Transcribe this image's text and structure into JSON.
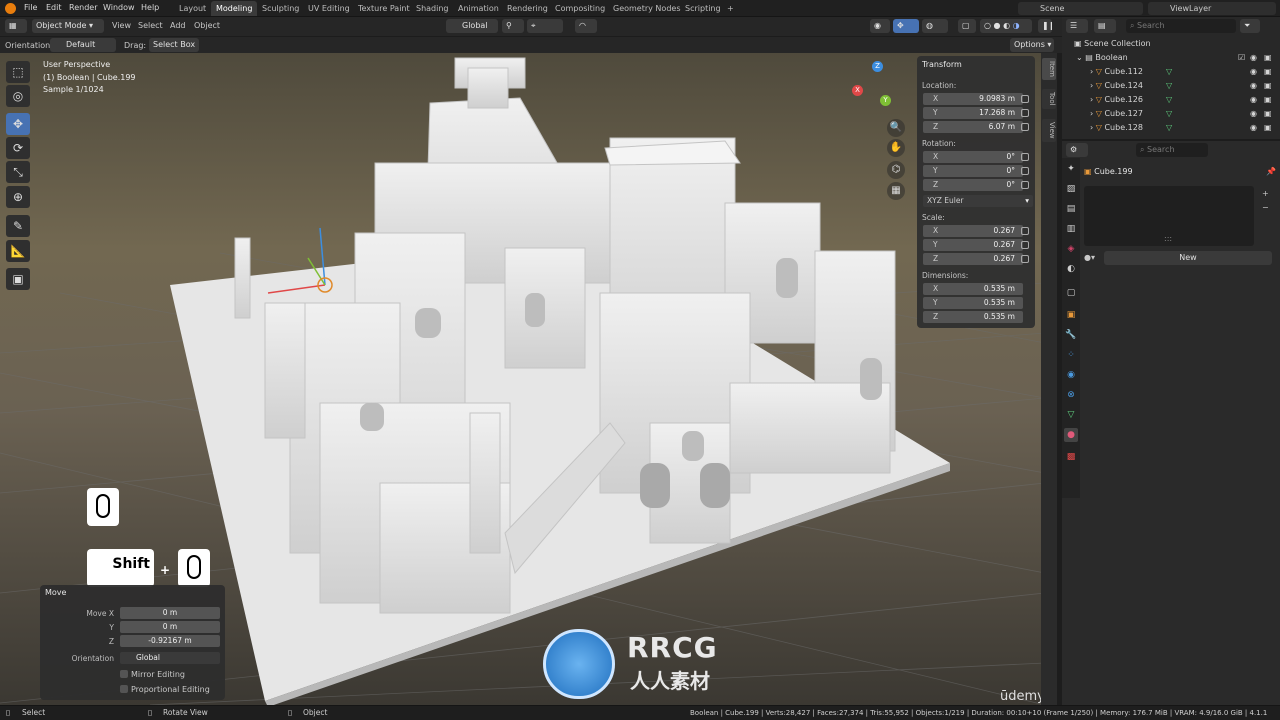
{
  "topbar": {
    "menus": [
      "File",
      "Edit",
      "Render",
      "Window",
      "Help"
    ],
    "workspaces": [
      "Layout",
      "Modeling",
      "Sculpting",
      "UV Editing",
      "Texture Paint",
      "Shading",
      "Animation",
      "Rendering",
      "Compositing",
      "Geometry Nodes",
      "Scripting"
    ],
    "active_workspace": "Modeling",
    "add_tab": "+",
    "scene": "Scene",
    "view_layer": "ViewLayer"
  },
  "header": {
    "mode": "Object Mode",
    "menus": [
      "View",
      "Select",
      "Add",
      "Object"
    ],
    "transform_orientation": "Global",
    "options": "Options"
  },
  "tool_header": {
    "orientation_label": "Orientation:",
    "orientation_value": "Default",
    "drag_label": "Drag:",
    "drag_value": "Select Box"
  },
  "viewport": {
    "info_line1": "User Perspective",
    "info_line2": "(1) Boolean | Cube.199",
    "info_line3": "Sample 1/1024",
    "gizmo_axes": {
      "z": "Z",
      "x": "X",
      "y": "Y"
    },
    "keyhint_shift": "Shift",
    "keyhint_plus": "+"
  },
  "sidebar_tabs": [
    "Item",
    "Tool",
    "View"
  ],
  "transform_panel": {
    "title": "Transform",
    "location_label": "Location:",
    "location": [
      {
        "axis": "X",
        "value": "9.0983 m"
      },
      {
        "axis": "Y",
        "value": "17.268 m"
      },
      {
        "axis": "Z",
        "value": "6.07 m"
      }
    ],
    "rotation_label": "Rotation:",
    "rotation": [
      {
        "axis": "X",
        "value": "0°"
      },
      {
        "axis": "Y",
        "value": "0°"
      },
      {
        "axis": "Z",
        "value": "0°"
      }
    ],
    "rotation_mode": "XYZ Euler",
    "scale_label": "Scale:",
    "scale": [
      {
        "axis": "X",
        "value": "0.267"
      },
      {
        "axis": "Y",
        "value": "0.267"
      },
      {
        "axis": "Z",
        "value": "0.267"
      }
    ],
    "dimensions_label": "Dimensions:",
    "dimensions": [
      {
        "axis": "X",
        "value": "0.535 m"
      },
      {
        "axis": "Y",
        "value": "0.535 m"
      },
      {
        "axis": "Z",
        "value": "0.535 m"
      }
    ]
  },
  "move_panel": {
    "title": "Move",
    "move_x_label": "Move X",
    "move_x": "0 m",
    "y_label": "Y",
    "y": "0 m",
    "z_label": "Z",
    "z": "-0.92167 m",
    "orientation_label": "Orientation",
    "orientation": "Global",
    "mirror": "Mirror Editing",
    "proportional": "Proportional Editing"
  },
  "outliner": {
    "search_placeholder": "Search",
    "root": "Scene Collection",
    "collection": "Boolean",
    "items": [
      "Cube.112",
      "Cube.124",
      "Cube.126",
      "Cube.127",
      "Cube.128"
    ]
  },
  "properties": {
    "search_placeholder": "Search",
    "object_name": "Cube.199",
    "new_button": "New",
    "dots": ":::"
  },
  "statusbar": {
    "select": "Select",
    "rotate": "Rotate View",
    "object": "Object",
    "stats": "Boolean | Cube.199 | Verts:28,427 | Faces:27,374 | Tris:55,952 | Objects:1/219 | Duration: 00:10+10 (Frame 1/250) | Memory: 176.7 MiB | VRAM: 4.9/16.0 GiB | 4.1.1"
  },
  "watermark": {
    "brand": "RRCG",
    "sub": "人人素材",
    "udemy": "ūdemy"
  },
  "colors": {
    "accent": "#4772b3",
    "x_axis": "#e04848",
    "y_axis": "#7fbf35",
    "z_axis": "#3c8ee0"
  }
}
